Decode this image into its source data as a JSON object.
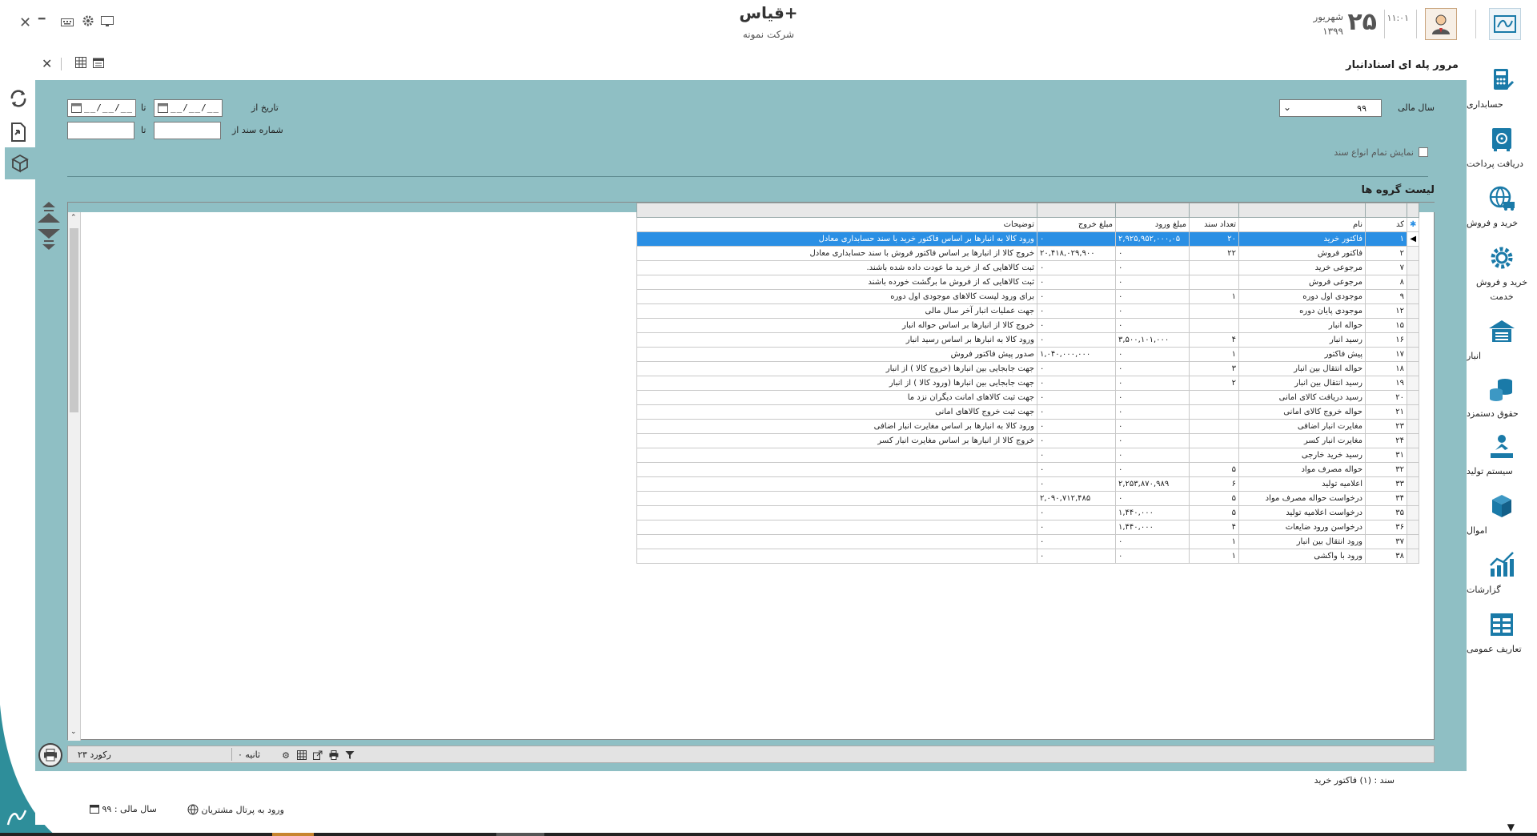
{
  "app": {
    "title": "قیاس+",
    "company": "شرکت نمونه",
    "date_day": "۲۵",
    "date_month": "شهریور",
    "date_year": "۱۳۹۹",
    "clock": "۱۱:۰۱"
  },
  "window_controls": {
    "close": "✕",
    "minimize": "━"
  },
  "sidebar": {
    "items": [
      {
        "label": "حسابداری",
        "icon": "calculator-icon"
      },
      {
        "label": "دریافت پرداخت",
        "icon": "safe-icon"
      },
      {
        "label": "خرید و فروش",
        "icon": "globe-truck-icon"
      },
      {
        "label": "خرید و فروش خدمت",
        "icon": "gear-icon"
      },
      {
        "label": "انبار",
        "icon": "warehouse-icon"
      },
      {
        "label": "حقوق دستمزد",
        "icon": "coins-icon"
      },
      {
        "label": "سیستم تولید",
        "icon": "worker-icon"
      },
      {
        "label": "اموال",
        "icon": "box-icon"
      },
      {
        "label": "گزارشات",
        "icon": "chart-icon"
      },
      {
        "label": "تعاریف عمومی",
        "icon": "table-icon"
      }
    ]
  },
  "form": {
    "title": "مرور پله ای اسنادانبار",
    "fiscal_year_label": "سال مالی",
    "fiscal_year_value": "۹۹",
    "date_from_label": "تاریخ از",
    "date_to_label": "تا",
    "date_from_value": "__/__/__",
    "date_to_value": "__/__/__",
    "doc_no_from_label": "شماره سند از",
    "doc_no_to_label": "تا",
    "show_all_label": "نمایش تمام انواع سند",
    "group_list_title": "لیست گروه ها"
  },
  "grid": {
    "columns": [
      "کد",
      "نام",
      "تعداد سند",
      "مبلغ ورود",
      "مبلغ خروج",
      "توضیحات"
    ],
    "rows": [
      [
        "۱",
        "فاکتور خرید",
        "۲۰",
        "۲,۹۲۵,۹۵۲,۰۰۰,۰۵",
        "۰",
        "ورود کالا به انبارها بر اساس فاکتور خرید با سند حسابداری معادل"
      ],
      [
        "۲",
        "فاکتور فروش",
        "۲۲",
        "۰",
        "۲۰,۴۱۸,۰۲۹,۹۰۰",
        "خروج کالا از انبارها بر اساس فاکتور فروش با سند حسابداری معادل"
      ],
      [
        "۷",
        "مرجوعی خرید",
        "",
        "۰",
        "۰",
        "ثبت کالاهایی که از خرید ما عودت داده شده باشند."
      ],
      [
        "۸",
        "مرجوعی فروش",
        "",
        "۰",
        "۰",
        "ثبت کالاهایی که از فروش ما برگشت خورده باشند"
      ],
      [
        "۹",
        "موجودی اول دوره",
        "۱",
        "۰",
        "۰",
        "برای ورود لیست کالاهای موجودی اول دوره"
      ],
      [
        "۱۲",
        "موجودی پایان دوره",
        "",
        "۰",
        "۰",
        "جهت عملیات انبار آخر سال مالی"
      ],
      [
        "۱۵",
        "حواله انبار",
        "",
        "۰",
        "۰",
        "خروج کالا از انبارها بر اساس حواله انبار"
      ],
      [
        "۱۶",
        "رسید انبار",
        "۴",
        "۳,۵۰۰,۱۰۱,۰۰۰",
        "۰",
        "ورود کالا به انبارها بر اساس رسید انبار"
      ],
      [
        "۱۷",
        "پیش فاکتور",
        "۱",
        "۰",
        "۱,۰۴۰,۰۰۰,۰۰۰",
        "صدور پیش فاکتور فروش"
      ],
      [
        "۱۸",
        "حواله انتقال بین انبار",
        "۳",
        "۰",
        "۰",
        "جهت جابجایی بین انبارها (خروج کالا ) از انبار"
      ],
      [
        "۱۹",
        "رسید انتقال بین انبار",
        "۲",
        "۰",
        "۰",
        "جهت جابجایی بین انبارها (ورود کالا ) از انبار"
      ],
      [
        "۲۰",
        "رسید دریافت کالای امانی",
        "",
        "۰",
        "۰",
        "جهت ثبت کالاهای امانت دیگران نزد ما"
      ],
      [
        "۲۱",
        "حواله خروج کالای امانی",
        "",
        "۰",
        "۰",
        "جهت ثبت خروج کالاهای امانی"
      ],
      [
        "۲۳",
        "مغایرت انبار اضافی",
        "",
        "۰",
        "۰",
        "ورود کالا به انبارها بر اساس مغایرت انبار اضافی"
      ],
      [
        "۲۴",
        "مغایرت انبار کسر",
        "",
        "۰",
        "۰",
        "خروج کالا از انبارها بر اساس مغایرت انبار کسر"
      ],
      [
        "۳۱",
        "رسید خرید خارجی",
        "",
        "۰",
        "۰",
        ""
      ],
      [
        "۳۲",
        "حواله مصرف مواد",
        "۵",
        "۰",
        "۰",
        ""
      ],
      [
        "۳۳",
        "اعلامیه تولید",
        "۶",
        "۲,۲۵۳,۸۷۰,۹۸۹",
        "۰",
        ""
      ],
      [
        "۳۴",
        "درخواست حواله مصرف مواد",
        "۵",
        "۰",
        "۲,۰۹۰,۷۱۲,۴۸۵",
        ""
      ],
      [
        "۳۵",
        "درخواست اعلامیه تولید",
        "۵",
        "۱,۴۴۰,۰۰۰",
        "۰",
        ""
      ],
      [
        "۳۶",
        "درخواسن ورود ضایعات",
        "۴",
        "۱,۴۴۰,۰۰۰",
        "۰",
        ""
      ],
      [
        "۳۷",
        "ورود انتقال بین انبار",
        "۱",
        "۰",
        "۰",
        ""
      ],
      [
        "۳۸",
        "ورود با واکشی",
        "۱",
        "۰",
        "۰",
        ""
      ]
    ],
    "selected_row": 0
  },
  "footer": {
    "record_count": "۲۳ رکورد",
    "seconds": "۰ ثانیه",
    "status_doc": "سند : (۱) فاکتور خرید",
    "fiscal_year": "سال مالی : ۹۹",
    "portal_link": "ورود به پرتال مشتریان"
  },
  "colors": {
    "accent": "#1a7aa8",
    "panel": "#8fbfc4",
    "selected": "#2a8fe4"
  }
}
